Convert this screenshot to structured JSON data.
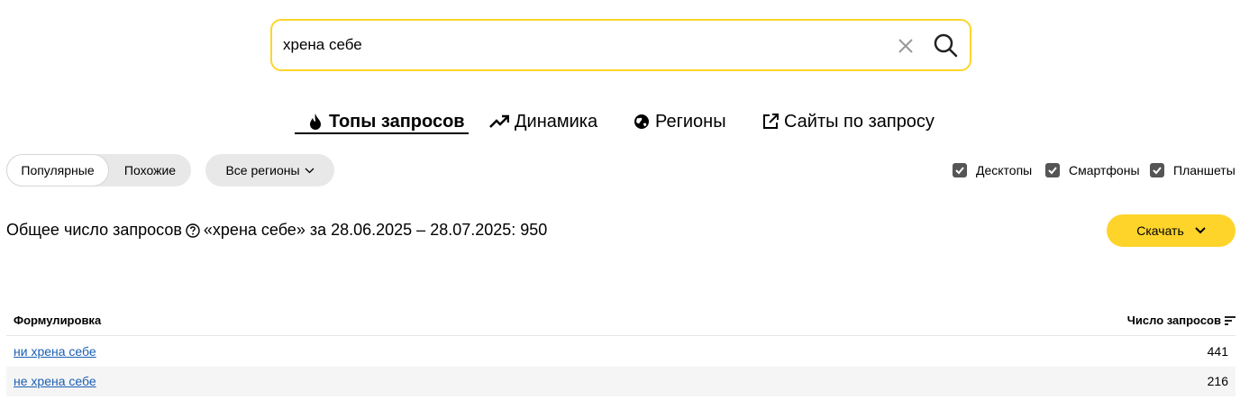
{
  "search": {
    "value": "хрена себе"
  },
  "icons": {
    "clear": "close-icon",
    "search": "search-icon"
  },
  "tabs": [
    {
      "label": "Топы запросов",
      "icon": "fire-icon",
      "active": true
    },
    {
      "label": "Динамика",
      "icon": "trend-icon",
      "active": false
    },
    {
      "label": "Регионы",
      "icon": "globe-icon",
      "active": false
    },
    {
      "label": "Сайты по запросу",
      "icon": "external-link-icon",
      "active": false
    }
  ],
  "filters": {
    "popular": "Популярные",
    "similar": "Похожие",
    "regions": "Все регионы"
  },
  "devices": [
    {
      "label": "Десктопы",
      "checked": true
    },
    {
      "label": "Смартфоны",
      "checked": true
    },
    {
      "label": "Планшеты",
      "checked": true
    }
  ],
  "summary": {
    "label": "Общее число запросов",
    "rest": "«хрена себе» за 28.06.2025 – 28.07.2025: 950"
  },
  "download": {
    "label": "Скачать"
  },
  "table": {
    "col_phrase": "Формулировка",
    "col_count": "Число запросов",
    "rows": [
      {
        "phrase": "ни хрена себе",
        "count": "441"
      },
      {
        "phrase": "не хрена себе",
        "count": "216"
      }
    ]
  },
  "colors": {
    "accent": "#fed42b",
    "link": "#1a5fb4"
  }
}
